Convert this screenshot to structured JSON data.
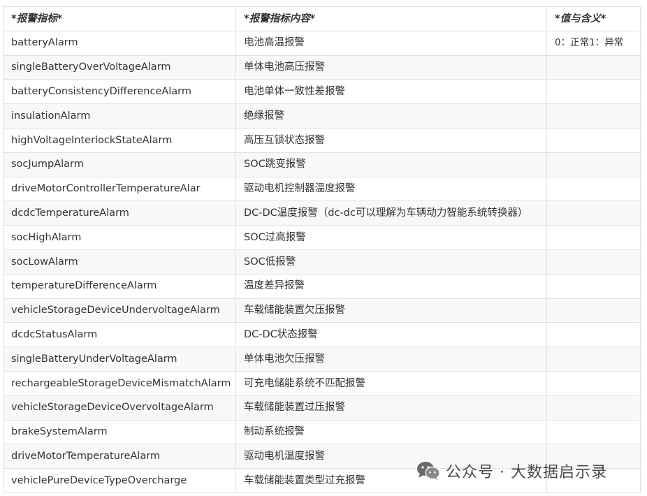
{
  "table": {
    "headers": [
      "*报警指标*",
      "*报警指标内容*",
      "*值与含义*"
    ],
    "rows": [
      {
        "name": "batteryAlarm",
        "content": "电池高温报警",
        "value": "0：正常1：异常"
      },
      {
        "name": "singleBatteryOverVoltageAlarm",
        "content": "单体电池高压报警",
        "value": ""
      },
      {
        "name": "batteryConsistencyDifferenceAlarm",
        "content": "电池单体一致性差报警",
        "value": ""
      },
      {
        "name": "insulationAlarm",
        "content": "绝缘报警",
        "value": ""
      },
      {
        "name": "highVoltageInterlockStateAlarm",
        "content": "高压互锁状态报警",
        "value": ""
      },
      {
        "name": "socJumpAlarm",
        "content": "SOC跳变报警",
        "value": ""
      },
      {
        "name": "driveMotorControllerTemperatureAlar",
        "content": "驱动电机控制器温度报警",
        "value": ""
      },
      {
        "name": "dcdcTemperatureAlarm",
        "content": "DC-DC温度报警（dc-dc可以理解为车辆动力智能系统转换器）",
        "value": ""
      },
      {
        "name": "socHighAlarm",
        "content": "SOC过高报警",
        "value": ""
      },
      {
        "name": "socLowAlarm",
        "content": "SOC低报警",
        "value": ""
      },
      {
        "name": "temperatureDifferenceAlarm",
        "content": "温度差异报警",
        "value": ""
      },
      {
        "name": "vehicleStorageDeviceUndervoltageAlarm",
        "content": "车载储能装置欠压报警",
        "value": ""
      },
      {
        "name": "dcdcStatusAlarm",
        "content": "DC-DC状态报警",
        "value": ""
      },
      {
        "name": "singleBatteryUnderVoltageAlarm",
        "content": "单体电池欠压报警",
        "value": ""
      },
      {
        "name": "rechargeableStorageDeviceMismatchAlarm",
        "content": "可充电储能系统不匹配报警",
        "value": ""
      },
      {
        "name": "vehicleStorageDeviceOvervoltageAlarm",
        "content": "车载储能装置过压报警",
        "value": ""
      },
      {
        "name": "brakeSystemAlarm",
        "content": "制动系统报警",
        "value": ""
      },
      {
        "name": "driveMotorTemperatureAlarm",
        "content": "驱动电机温度报警",
        "value": ""
      },
      {
        "name": "vehiclePureDeviceTypeOvercharge",
        "content": "车载储能装置类型过充报警",
        "value": ""
      }
    ]
  },
  "watermark": {
    "icon": "wechat-icon",
    "text": "公众号 · 大数据启示录"
  }
}
